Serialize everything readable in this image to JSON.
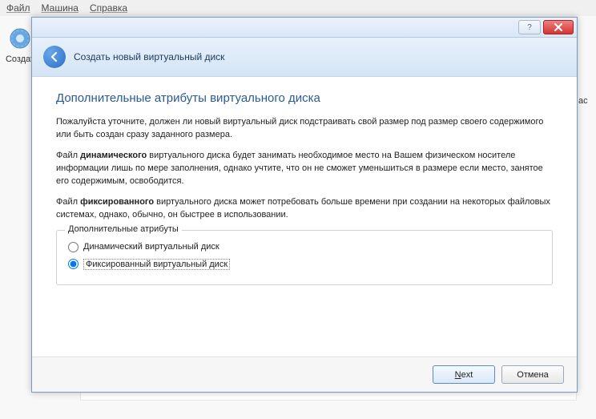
{
  "menubar": {
    "file": "Файл",
    "machine": "Машина",
    "help": "Справка"
  },
  "sidebar": {
    "create": "Создат"
  },
  "right_fragment": {
    "text": "ас"
  },
  "dialog": {
    "titlebar": {
      "help_label": "?",
      "close_label": "×"
    },
    "wizard": {
      "header_title": "Создать новый виртуальный диск"
    },
    "page": {
      "heading": "Дополнительные атрибуты виртуального диска",
      "para1": "Пожалуйста уточните, должен ли новый виртуальный диск подстраивать свой размер под размер своего содержимого или быть создан сразу заданного размера.",
      "para2_pre": "Файл ",
      "para2_bold": "динамического",
      "para2_post": " виртуального диска будет занимать необходимое место на Вашем физическом носителе информации лишь по мере заполнения, однако учтите, что он не сможет уменьшиться в размере если место, занятое его содержимым, освободится.",
      "para3_pre": "Файл ",
      "para3_bold": "фиксированного",
      "para3_post": " виртуального диска может потребовать больше времени при создании на некоторых файловых системах, однако, обычно, он быстрее в использовании."
    },
    "fieldset": {
      "legend": "Дополнительные атрибуты",
      "option_dynamic": "Динамический виртуальный диск",
      "option_fixed": "Фиксированный виртуальный диск",
      "selected": "fixed"
    },
    "footer": {
      "next_underline": "N",
      "next_rest": "ext",
      "cancel": "Отмена"
    }
  }
}
